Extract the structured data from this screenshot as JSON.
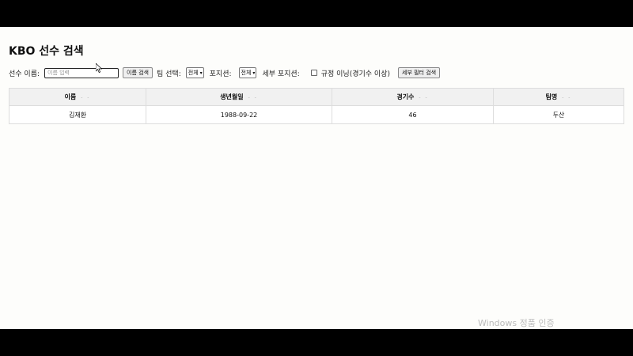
{
  "page": {
    "title": "KBO 선수 검색"
  },
  "controls": {
    "name_label": "선수 이름:",
    "name_placeholder": "이름 입력",
    "name_search_label": "이름 검색",
    "team_label": "팀 선택:",
    "team_value": "전체",
    "position_label": "포지션:",
    "position_value": "전체",
    "sub_position_label": "세부 포지션:",
    "qualified_label": "규정 이닝(경기수 이상)",
    "qualified_checked": false,
    "filter_search_label": "세부 필터 검색"
  },
  "table": {
    "columns": [
      "이름",
      "생년월일",
      "경기수",
      "팀명"
    ],
    "sort_marker": "- -",
    "rows": [
      [
        "김재환",
        "1988-09-22",
        "46",
        "두산"
      ]
    ]
  },
  "watermark": {
    "text": "Windows 정품 인증"
  },
  "colors": {
    "background": "#fdfdfb",
    "header": "#f1f1f1",
    "border": "#dddddd"
  }
}
